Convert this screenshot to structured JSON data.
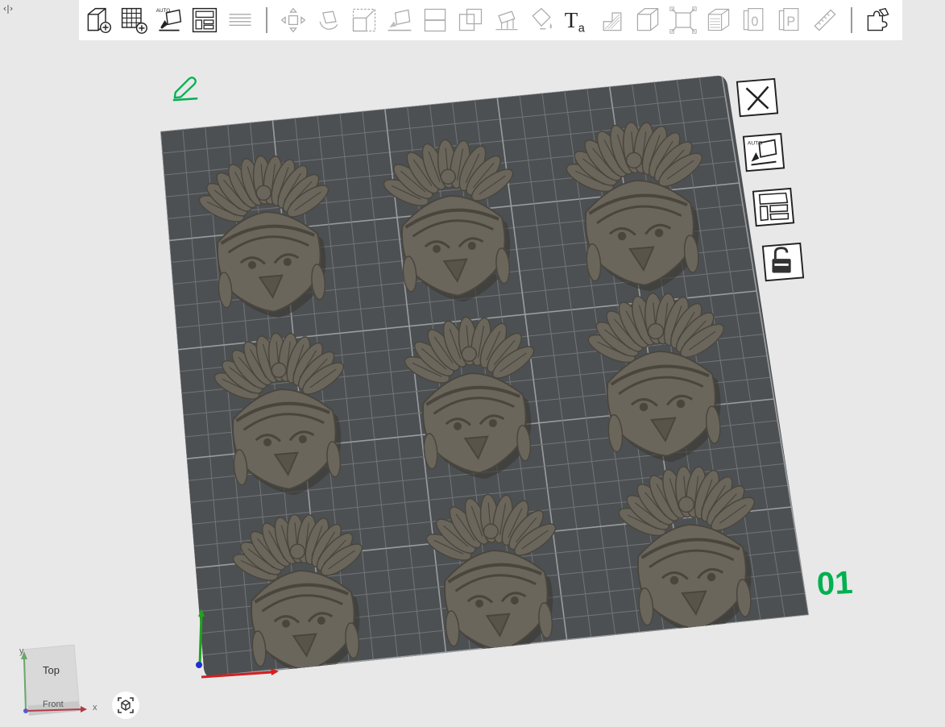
{
  "panel_toggle": {
    "glyph": "‹|›"
  },
  "toolbar": {
    "buttons": [
      {
        "name": "add-cube-button",
        "icon": "cube-plus-icon",
        "enabled": true
      },
      {
        "name": "add-grid-button",
        "icon": "grid-plus-icon",
        "enabled": true
      },
      {
        "name": "auto-orient-button",
        "icon": "auto-orient-icon",
        "label": "AUTO",
        "enabled": true
      },
      {
        "name": "arrange-button",
        "icon": "layout-icon",
        "enabled": true
      },
      {
        "name": "list-view-button",
        "icon": "list-lines-icon",
        "enabled": false
      },
      {
        "name": "move-button",
        "icon": "move-arrows-icon",
        "enabled": false
      },
      {
        "name": "rotate-button",
        "icon": "rotate-icon",
        "enabled": false
      },
      {
        "name": "scale-button",
        "icon": "scale-icon",
        "enabled": false
      },
      {
        "name": "lay-flat-button",
        "icon": "lay-flat-icon",
        "enabled": false
      },
      {
        "name": "cut-button",
        "icon": "cut-plane-icon",
        "enabled": false
      },
      {
        "name": "boolean-button",
        "icon": "boolean-icon",
        "enabled": false
      },
      {
        "name": "supports-button",
        "icon": "supports-icon",
        "enabled": false
      },
      {
        "name": "paint-button",
        "icon": "paint-bucket-icon",
        "enabled": false
      },
      {
        "name": "text-button",
        "icon": "text-icon",
        "enabled": true
      },
      {
        "name": "measure-height-button",
        "icon": "height-range-icon",
        "enabled": false
      },
      {
        "name": "assembly-button",
        "icon": "assembly-cube-icon",
        "enabled": false
      },
      {
        "name": "fit-button",
        "icon": "fit-frame-icon",
        "enabled": false
      },
      {
        "name": "layers-button",
        "icon": "layers-icon",
        "enabled": false
      },
      {
        "name": "variable-layer-button",
        "icon": "variable-layer-icon",
        "enabled": false
      },
      {
        "name": "plate-p-button",
        "icon": "plate-p-icon",
        "enabled": false
      },
      {
        "name": "ruler-button",
        "icon": "ruler-icon",
        "enabled": false
      },
      {
        "name": "split-parts-button",
        "icon": "puzzle-icon",
        "enabled": true
      }
    ],
    "text_icon_main": "T",
    "text_icon_sub": "a",
    "plate_zero_letter": "0",
    "plate_p_letter": "P"
  },
  "plate": {
    "number": "01",
    "objects_count": 9,
    "edit_icon": "pencil-icon"
  },
  "side_tools": {
    "close": "close-icon",
    "auto": "auto-orient-icon",
    "auto_label": "AUTO",
    "arrange": "layout-icon",
    "lock": "unlock-icon"
  },
  "viewcube": {
    "top_label": "Top",
    "front_label": "Front",
    "axis_x": "x",
    "axis_y": "y"
  },
  "colors": {
    "background": "#e8e8e8",
    "plate": "#4d5052",
    "grid_line": "#727578",
    "grid_major": "#9a9da0",
    "model": "#6b665b",
    "model_edge": "#4a463e",
    "plate_number": "#00b050",
    "pencil": "#00b050",
    "axis_x": "#d32020",
    "axis_y": "#1ea51e",
    "axis_z": "#1f2fd0"
  }
}
